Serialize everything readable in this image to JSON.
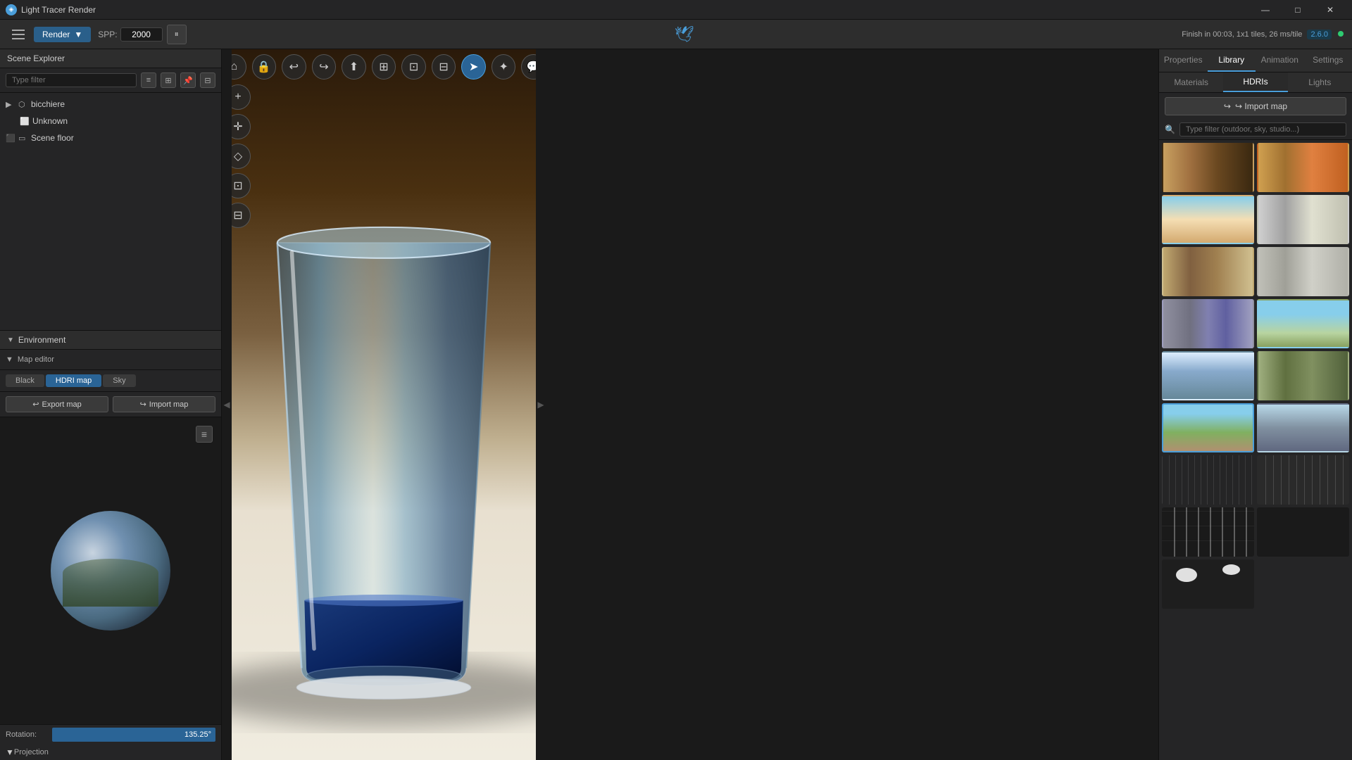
{
  "titlebar": {
    "title": "Light Tracer Render",
    "icon": "◈",
    "minimize": "—",
    "maximize": "□",
    "close": "✕"
  },
  "toolbar": {
    "menu_label": "≡",
    "render_label": "Render",
    "render_arrow": "▼",
    "spp_label": "SPP:",
    "spp_value": "2000",
    "pause_icon": "⏸",
    "finish_text": "Finish in 00:03, 1x1 tiles, 26 ms/tile",
    "version": "2.6.0",
    "online_indicator": "●"
  },
  "scene_explorer": {
    "title": "Scene Explorer",
    "search_placeholder": "Type filter",
    "items": [
      {
        "label": "bicchiere",
        "type": "group",
        "indent": 0
      },
      {
        "label": "Unknown",
        "type": "mesh",
        "indent": 1
      },
      {
        "label": "Scene floor",
        "type": "plane",
        "indent": 0
      }
    ]
  },
  "viewport_toolbar": {
    "buttons": [
      {
        "icon": "⌂",
        "name": "home",
        "active": false
      },
      {
        "icon": "🔒",
        "name": "lock",
        "active": false
      },
      {
        "icon": "↩",
        "name": "undo",
        "active": false
      },
      {
        "icon": "↪",
        "name": "redo",
        "active": false
      },
      {
        "icon": "⬆",
        "name": "upload",
        "active": false
      },
      {
        "icon": "⊞",
        "name": "render-frame",
        "active": false
      },
      {
        "icon": "⊡",
        "name": "grid",
        "active": false
      },
      {
        "icon": "⊟",
        "name": "split",
        "active": false
      },
      {
        "icon": "➤",
        "name": "render-active",
        "active": true
      },
      {
        "icon": "✦",
        "name": "sparkle",
        "active": false
      },
      {
        "icon": "💬",
        "name": "discord",
        "active": false
      }
    ]
  },
  "viewport_side_tools": {
    "buttons": [
      {
        "icon": "+",
        "name": "add"
      },
      {
        "icon": "✛",
        "name": "transform"
      },
      {
        "icon": "◇",
        "name": "select"
      },
      {
        "icon": "▣",
        "name": "frame"
      },
      {
        "icon": "⊡",
        "name": "region"
      }
    ]
  },
  "environment": {
    "title": "Environment",
    "map_editor_label": "Map editor",
    "tabs": [
      "Black",
      "HDRI map",
      "Sky"
    ],
    "active_tab": "HDRI map",
    "export_label": "Export map",
    "import_label": "Import map",
    "rotation_label": "Rotation:",
    "rotation_value": "135.25°",
    "projection_label": "Projection",
    "chevron": "▼"
  },
  "right_panel": {
    "tabs": [
      "Properties",
      "Library",
      "Animation",
      "Settings"
    ],
    "active_tab": "Library",
    "material_tabs": [
      "Materials",
      "HDRIs",
      "Lights"
    ],
    "active_material_tab": "HDRIs",
    "import_map_label": "↪ Import map",
    "search_placeholder": "Type filter (outdoor, sky, studio...)",
    "hdri_thumbs": [
      {
        "id": 1,
        "class": "hdri-1"
      },
      {
        "id": 2,
        "class": "hdri-2"
      },
      {
        "id": 3,
        "class": "hdri-3"
      },
      {
        "id": 4,
        "class": "hdri-4"
      },
      {
        "id": 5,
        "class": "hdri-5"
      },
      {
        "id": 6,
        "class": "hdri-6"
      },
      {
        "id": 7,
        "class": "hdri-7"
      },
      {
        "id": 8,
        "class": "hdri-8"
      },
      {
        "id": 9,
        "class": "hdri-9"
      },
      {
        "id": 10,
        "class": "hdri-10"
      },
      {
        "id": 11,
        "class": "hdri-11"
      },
      {
        "id": 12,
        "class": "hdri-12"
      },
      {
        "id": 13,
        "class": "hdri-13"
      },
      {
        "id": 14,
        "class": "hdri-14"
      },
      {
        "id": 15,
        "class": "hdri-15"
      },
      {
        "id": 16,
        "class": "hdri-16"
      },
      {
        "id": 17,
        "class": "hdri-17"
      }
    ]
  }
}
